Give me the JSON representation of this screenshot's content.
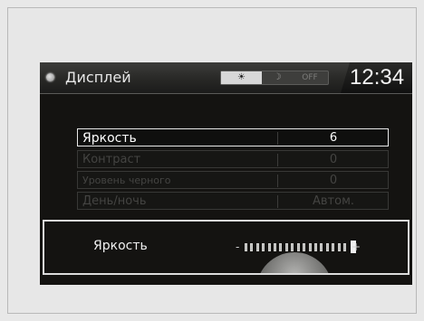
{
  "status_bar": {
    "title": "Дисплей",
    "mode_day": "☀",
    "mode_night": "☽",
    "mode_off": "OFF",
    "clock": "12:34"
  },
  "menu": [
    {
      "label": "Яркость",
      "value": "6"
    },
    {
      "label": "Контраст",
      "value": "0"
    },
    {
      "label": "Уровень черного",
      "value": "0"
    },
    {
      "label": "День/ночь",
      "value": "Автом."
    }
  ],
  "adjust": {
    "label": "Яркость",
    "minus": "-",
    "plus": "+",
    "level": 6,
    "min": -5,
    "max": 5
  },
  "colors": {
    "screen_bg": "#141311",
    "highlight_border": "#e8e8e8",
    "dim_text": "#444442"
  }
}
